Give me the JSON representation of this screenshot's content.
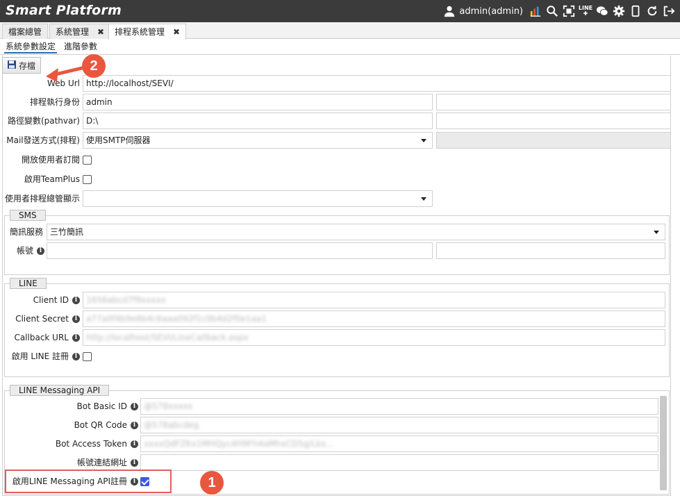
{
  "app": {
    "title": "Smart Platform",
    "user": "admin(admin)"
  },
  "header_icons": [
    "user-icon",
    "chart-icon",
    "search-icon",
    "fullscreen-icon",
    "line-icon",
    "wechat-icon",
    "gear-icon",
    "mobile-icon",
    "refresh-icon",
    "logout-icon"
  ],
  "header_line_text": "LINE",
  "tabs": [
    {
      "label": "檔案總管",
      "closable": false
    },
    {
      "label": "系統管理",
      "closable": true
    },
    {
      "label": "排程系統管理",
      "closable": true,
      "active": true
    }
  ],
  "tab_close_glyph": "✖",
  "subtabs": [
    {
      "label": "系統參數設定",
      "active": true
    },
    {
      "label": "進階參數"
    }
  ],
  "toolbar": {
    "save_label": "存檔"
  },
  "form": {
    "web_url": {
      "label": "Web Url",
      "value": "http://localhost/SEVI/"
    },
    "run_as": {
      "label": "排程執行身份",
      "value": "admin"
    },
    "pathvar": {
      "label": "路徑變數(pathvar)",
      "value": "D:\\"
    },
    "mail_method": {
      "label": "Mail發送方式(排程)",
      "value": "使用SMTP伺服器"
    },
    "open_subscribe": {
      "label": "開放使用者訂閱",
      "checked": false
    },
    "enable_teamplus": {
      "label": "啟用TeamPlus",
      "checked": false
    },
    "user_schedule_display": {
      "label": "使用者排程總管顯示",
      "value": ""
    }
  },
  "sms": {
    "legend": "SMS",
    "service": {
      "label": "簡訊服務",
      "value": "三竹簡訊"
    },
    "account": {
      "label": "帳號",
      "value": ""
    }
  },
  "line": {
    "legend": "LINE",
    "client_id": {
      "label": "Client ID",
      "value": "1656abcd7f9xxxxx"
    },
    "client_secret": {
      "label": "Client Secret",
      "value": "a77a0f4b9e8b4c6aaa092f1c0b4d2f0e1aa1"
    },
    "callback_url": {
      "label": "Callback URL",
      "value": "http://localhost/SEVI/LineCallback.aspx"
    },
    "enable_register": {
      "label": "啟用 LINE 註冊",
      "checked": false
    }
  },
  "line_messaging": {
    "legend": "LINE Messaging API",
    "bot_basic_id": {
      "label": "Bot Basic ID",
      "value": "@578xxxxx"
    },
    "bot_qr_code": {
      "label": "Bot QR Code",
      "value": "@578abcdeg"
    },
    "bot_access_token": {
      "label": "Bot Access Token",
      "value": "xxxxQdFZKx1MHQyc4H9Fh4aMhxCD5g/Lkx..."
    },
    "account_link_url": {
      "label": "帳號連結網址",
      "value": ""
    },
    "enable_register": {
      "label": "啟用LINE Messaging API註冊",
      "checked": true
    }
  },
  "annotations": {
    "callout_1": "1",
    "callout_2": "2"
  },
  "colors": {
    "header_bg": "#3b3b3b",
    "accent": "#e9573f",
    "checkbox_on": "#3b5bdb"
  }
}
